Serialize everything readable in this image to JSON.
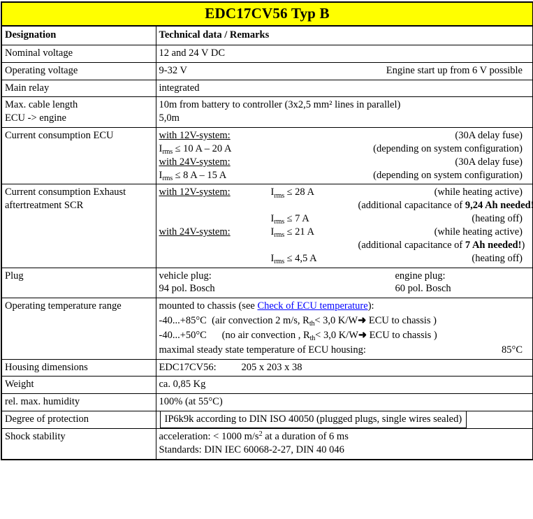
{
  "title": "EDC17CV56 Typ B",
  "colors": {
    "title_background": "#ffff00",
    "link": "#0000ff",
    "border": "#000000",
    "text": "#000000"
  },
  "header": {
    "designation": "Designation",
    "technical_data": "Technical data  / Remarks"
  },
  "rows": {
    "nominal_voltage": {
      "label": "Nominal voltage",
      "value": "12 and 24 V DC"
    },
    "operating_voltage": {
      "label": "Operating voltage",
      "value": "9-32 V",
      "note": "Engine start up from 6 V possible"
    },
    "main_relay": {
      "label": "Main relay",
      "value": "integrated"
    },
    "cable_length": {
      "label_line1": "Max. cable length",
      "label_line2": "ECU -> engine",
      "value_line1": "10m from battery to controller (3x2,5 mm² lines in parallel)",
      "value_line2": "5,0m"
    },
    "current_ecu": {
      "label": "Current consumption ECU",
      "system_12v": "with 12V-system:",
      "fuse_12v": "(30A delay fuse)",
      "current_12v_prefix": "I",
      "current_12v_sub": "rms",
      "current_12v_value": "≤ 10 A – 20 A",
      "depends_12v": "(depending on system configuration)",
      "system_24v": "with 24V-system:",
      "fuse_24v": "(30A delay fuse)",
      "current_24v_prefix": "I",
      "current_24v_sub": "rms",
      "current_24v_value": "≤  8 A – 15 A",
      "depends_24v": "(depending on system configuration)"
    },
    "current_scr": {
      "label_line1": "Current consumption  Exhaust",
      "label_line2": "aftertreatment  SCR",
      "system_12v": "with 12V-system:",
      "i12_heat_value": "≤ 28 A",
      "i12_heat_note": "(while heating active)",
      "cap12_pre": "(additional capacitance of ",
      "cap12_bold": "9,24 Ah needed!",
      "cap12_post": ")",
      "i12_off_value": "≤  7 A",
      "i12_off_note": "(heating off)",
      "system_24v": "with 24V-system:",
      "i24_heat_value": "≤ 21 A",
      "i24_heat_note": "(while heating active)",
      "cap24_pre": "(additional capacitance of ",
      "cap24_bold": "7 Ah needed!",
      "cap24_post": ")",
      "i24_off_value": "≤  4,5 A",
      "i24_off_note": "(heating off)",
      "i_prefix": "I",
      "i_sub": "rms"
    },
    "plug": {
      "label": "Plug",
      "vehicle_plug_label": "vehicle plug:",
      "vehicle_plug_value": "94 pol. Bosch",
      "engine_plug_label": "engine plug:",
      "engine_plug_value": "60 pol. Bosch"
    },
    "operating_temperature": {
      "label": "Operating temperature range",
      "mount_pre": "mounted to chassis (see ",
      "mount_link": "Check of ECU temperature",
      "mount_post": "):",
      "range1_temp": "-40...+85°C",
      "range1_note_a": "(air convection 2 m/s,  R",
      "range1_note_sub": "th",
      "range1_note_b": "< 3,0 K/W",
      "arrow": "➜",
      "range1_note_c": " ECU to chassis )",
      "range2_temp": "-40...+50°C",
      "range2_note_a": "(no air convection , R",
      "range2_note_sub": "th",
      "range2_note_b": "< 3,0 K/W",
      "range2_note_c": " ECU to chassis )",
      "steady_label": "maximal steady state temperature of ECU housing:",
      "steady_value": "85°C"
    },
    "housing_dimensions": {
      "label": "Housing dimensions",
      "part": "EDC17CV56:",
      "value": "205 x 203 x 38"
    },
    "weight": {
      "label": "Weight",
      "value": "ca. 0,85 Kg"
    },
    "humidity": {
      "label": "rel. max. humidity",
      "value": "100% (at 55°C)"
    },
    "protection": {
      "label": "Degree of protection",
      "value": "IP6k9k according to DIN ISO 40050 (plugged plugs, single wires sealed)"
    },
    "shock": {
      "label": "Shock stability",
      "value_line1_a": "acceleration: < 1000 m/s",
      "value_line1_sup": "2",
      "value_line1_b": " at a duration of 6 ms",
      "value_line2": "Standards: DIN IEC 60068-2-27, DIN 40 046"
    }
  }
}
